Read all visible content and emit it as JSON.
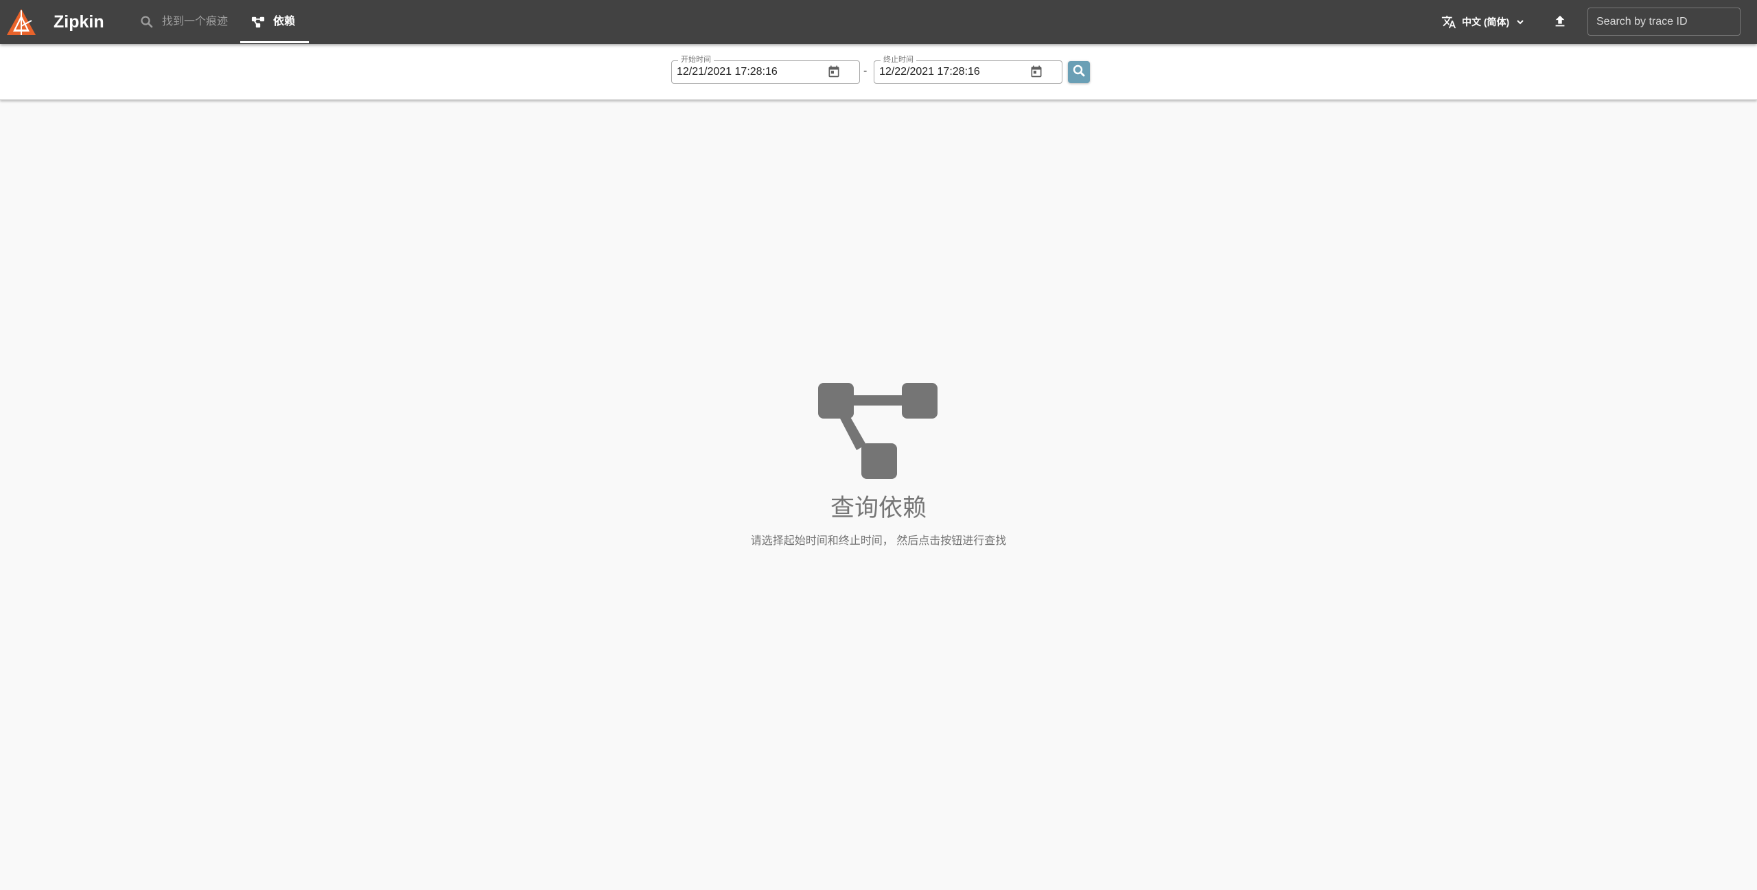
{
  "app": {
    "title": "Zipkin",
    "brand_color": "#e8632b",
    "appbar_color": "#424242"
  },
  "nav": {
    "tabs": [
      {
        "label": "找到一个痕迹",
        "icon": "search-icon",
        "active": false
      },
      {
        "label": "依赖",
        "icon": "dependency-graph-icon",
        "active": true
      }
    ]
  },
  "language": {
    "label": "中文 (简体)",
    "icon": "translate-icon"
  },
  "upload": {
    "icon": "upload-icon"
  },
  "trace_search": {
    "placeholder": "Search by trace ID",
    "value": ""
  },
  "toolbar": {
    "start": {
      "label": "开始时间",
      "value": "12/21/2021 17:28:16",
      "icon": "calendar-icon"
    },
    "separator": "-",
    "end": {
      "label": "终止时间",
      "value": "12/22/2021 17:28:16",
      "icon": "calendar-icon"
    },
    "search_button": {
      "icon": "search-icon",
      "color": "#6a9fb5"
    }
  },
  "empty_state": {
    "icon": "dependency-graph-icon",
    "title": "查询依赖",
    "description": "请选择起始时间和终止时间， 然后点击按钮进行查找"
  }
}
